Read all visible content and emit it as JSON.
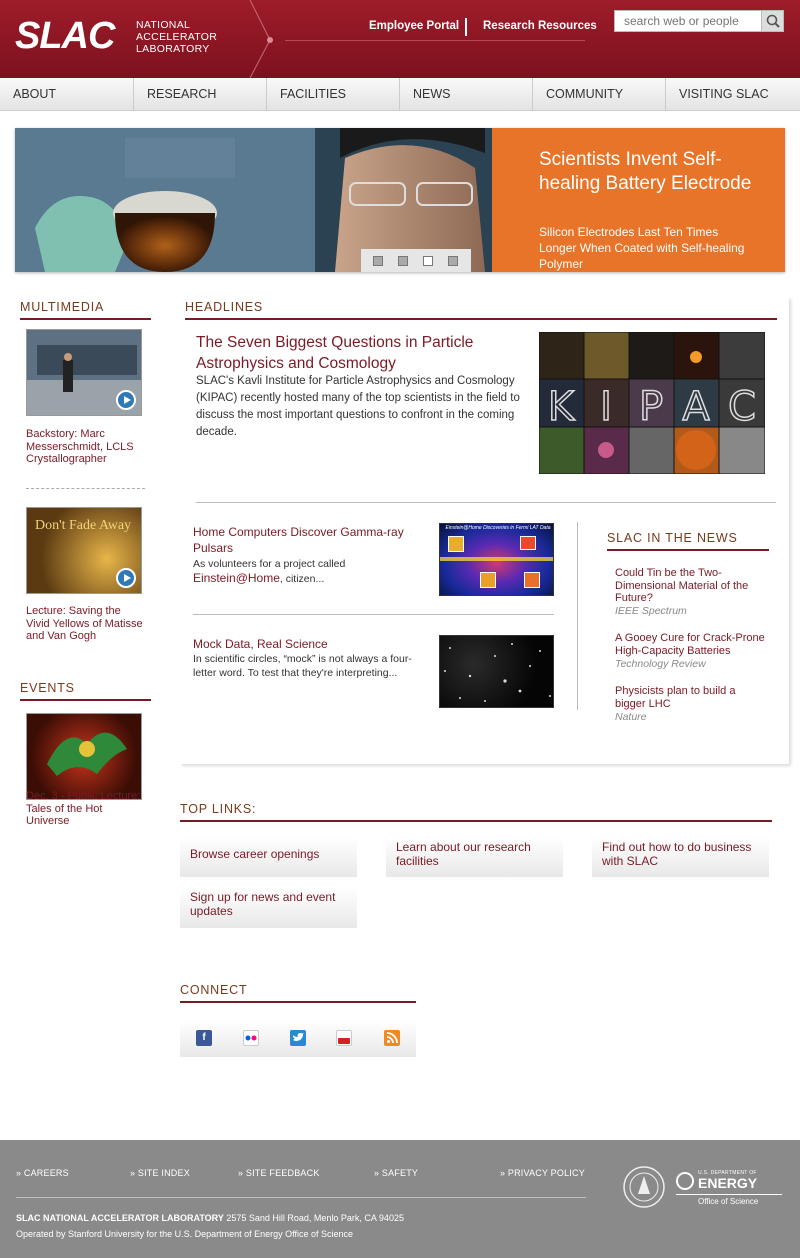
{
  "header": {
    "logo": "SLAC",
    "logo_text": [
      "NATIONAL",
      "ACCELERATOR",
      "LABORATORY"
    ],
    "links": [
      "Employee Portal",
      "Research Resources"
    ],
    "search_placeholder": "search web or people"
  },
  "nav": [
    "ABOUT",
    "RESEARCH",
    "FACILITIES",
    "NEWS",
    "COMMUNITY",
    "VISITING SLAC"
  ],
  "hero": {
    "title": "Scientists Invent Self-healing Battery Electrode",
    "subtitle": "Silicon Electrodes Last Ten Times Longer When Coated with Self-healing Polymer",
    "slides": 4,
    "active_slide": 3
  },
  "multimedia": {
    "heading": "MULTIMEDIA",
    "items": [
      {
        "caption": "Backstory: Marc Messerschmidt, LCLS Crystallographer"
      },
      {
        "caption": "Lecture: Saving the Vivid Yellows of Matisse and Van Gogh",
        "thumb_text": "Don't Fade Away"
      }
    ]
  },
  "events": {
    "heading": "EVENTS",
    "items": [
      {
        "caption": "Dec. 3 - Public Lecture: Tales of the Hot Universe"
      }
    ]
  },
  "headlines": {
    "heading": "HEADLINES",
    "main": {
      "title": "The Seven Biggest Questions in Particle Astrophysics and Cosmology",
      "body": "SLAC's Kavli Institute for Particle Astrophysics and Cosmology (KIPAC) recently hosted many of the top scientists in the field to discuss the most important questions to confront in the coming decade.",
      "image_letters": [
        "K",
        "I",
        "P",
        "A",
        "C"
      ]
    },
    "items": [
      {
        "title": "Home Computers Discover Gamma-ray Pulsars",
        "body": "As volunteers for a project called ",
        "link": "Einstein@Home",
        "body_after": ", citizen...",
        "img_caption": "Einstein@Home Discoveries in Fermi LAT Data"
      },
      {
        "title": "Mock Data, Real Science",
        "body": "In scientific circles, “mock” is not always a four-letter word. To test that they're interpreting..."
      }
    ]
  },
  "in_the_news": {
    "heading": "SLAC IN THE NEWS",
    "items": [
      {
        "title": "Could Tin be the Two-Dimensional Material of the Future?",
        "source": "IEEE Spectrum"
      },
      {
        "title": "A Gooey Cure for Crack-Prone High-Capacity Batteries",
        "source": "Technology Review"
      },
      {
        "title": "Physicists plan to build a bigger LHC",
        "source": "Nature"
      }
    ]
  },
  "top_links": {
    "heading": "TOP LINKS:",
    "items": [
      "Browse career openings",
      "Learn about our research facilities",
      "Find out how to do business with SLAC",
      "Sign up for news and event updates"
    ]
  },
  "connect": {
    "heading": "CONNECT",
    "icons": [
      "facebook-icon",
      "flickr-icon",
      "twitter-icon",
      "youtube-icon",
      "rss-icon"
    ]
  },
  "footer": {
    "links": [
      "» CAREERS",
      "» SITE INDEX",
      "» SITE FEEDBACK",
      "» SAFETY",
      "» PRIVACY POLICY"
    ],
    "org": "SLAC NATIONAL ACCELERATOR LABORATORY",
    "address": " 2575 Sand Hill Road, Menlo Park, CA 94025",
    "operated": "Operated by Stanford University for the U.S. Department of Energy Office of Science",
    "doe_top": "U.S. DEPARTMENT OF",
    "doe_name": "ENERGY",
    "doe_sub": "Office of Science"
  },
  "colors": {
    "maroon": "#7a1a24",
    "header": "#8e1724",
    "hero_panel": "#e8742a",
    "footer": "#8a8a8a"
  }
}
